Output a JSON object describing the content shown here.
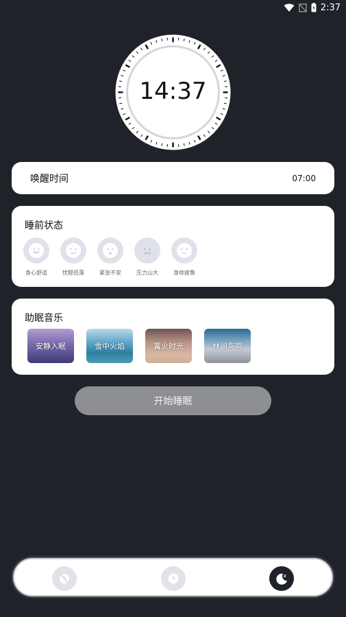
{
  "status_bar": {
    "time": "2:37",
    "icons": [
      "wifi-icon",
      "signal-off-icon",
      "battery-icon"
    ]
  },
  "clock": {
    "time": "14:37"
  },
  "wake": {
    "label": "唤醒时间",
    "value": "07:00"
  },
  "sleep_state": {
    "title": "睡前状态",
    "moods": [
      {
        "label": "身心舒适",
        "icon": "smile-face-icon"
      },
      {
        "label": "忧郁低落",
        "icon": "sad-face-icon"
      },
      {
        "label": "紧张不安",
        "icon": "worried-face-icon"
      },
      {
        "label": "压力山大",
        "icon": "frown-face-icon"
      },
      {
        "label": "身体疲惫",
        "icon": "tired-face-icon"
      }
    ]
  },
  "music": {
    "title": "助眠音乐",
    "tracks": [
      {
        "label": "安静入眠"
      },
      {
        "label": "雪中火焰"
      },
      {
        "label": "篝火时光"
      },
      {
        "label": "林间鸟鸣"
      }
    ]
  },
  "start_button": {
    "label": "开始睡眠"
  },
  "nav": {
    "items": [
      "alarm-off-icon",
      "clock-icon",
      "moon-sleep-icon"
    ],
    "active": "moon-sleep-icon"
  },
  "colors": {
    "background": "#1f2229",
    "card": "#ffffff",
    "button": "#8e8f93",
    "mood_bg": "#e0e2ea"
  }
}
